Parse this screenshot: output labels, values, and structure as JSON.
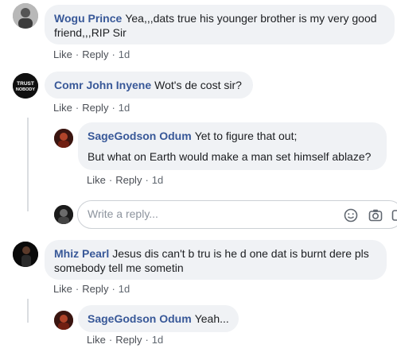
{
  "comments": [
    {
      "author": "Wogu Prince",
      "text": "Yea,,,dats true his younger brother is my very good friend,,,RIP Sir",
      "actions": {
        "like": "Like",
        "reply": "Reply",
        "time": "1d"
      }
    },
    {
      "author": "Comr John Inyene",
      "text": "Wot's de cost sir?",
      "avatar_text": [
        "TRUST",
        "NOBODY"
      ],
      "actions": {
        "like": "Like",
        "reply": "Reply",
        "time": "1d"
      },
      "replies": [
        {
          "author": "SageGodson Odum",
          "text": "Yet to figure that out;",
          "text2": "But what on Earth would make a man set himself ablaze?",
          "actions": {
            "like": "Like",
            "reply": "Reply",
            "time": "1d"
          }
        }
      ]
    },
    {
      "author": "Mhiz Pearl",
      "text": "Jesus dis can't b tru is he d one dat is burnt dere pls somebody tell me sometin",
      "actions": {
        "like": "Like",
        "reply": "Reply",
        "time": "1d"
      },
      "replies": [
        {
          "author": "SageGodson Odum",
          "text": "Yeah...",
          "actions": {
            "like": "Like",
            "reply": "Reply",
            "time": "1d"
          }
        }
      ]
    }
  ],
  "reply_box": {
    "placeholder": "Write a reply...",
    "icons": [
      "emoji-icon",
      "camera-icon",
      "gif-icon"
    ]
  },
  "separator": "·"
}
